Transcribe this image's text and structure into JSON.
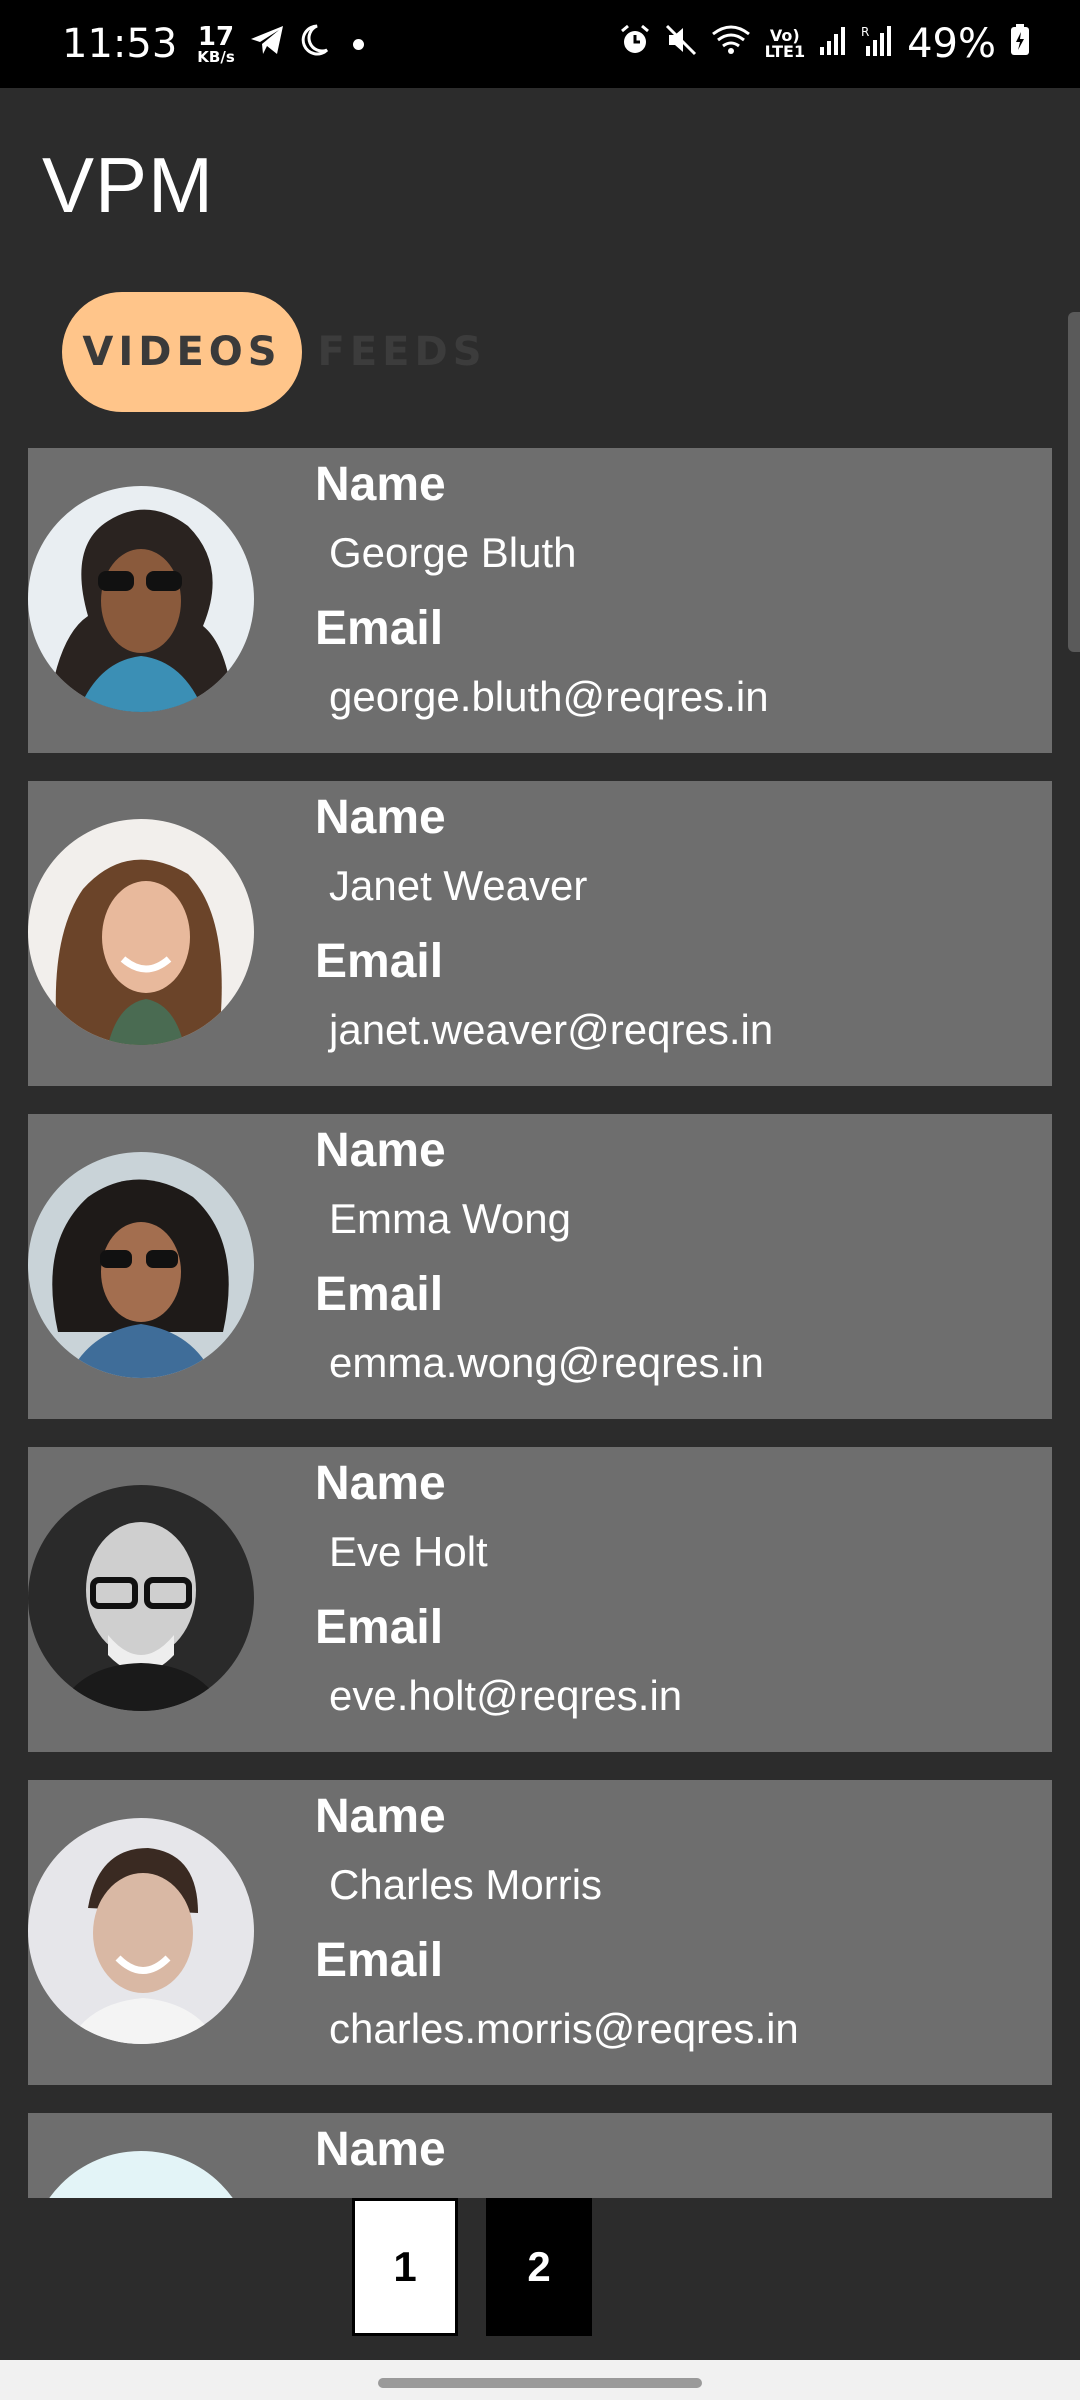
{
  "status_bar": {
    "time": "11:53",
    "speed_value": "17",
    "speed_unit": "KB/s",
    "battery": "49%",
    "icons": [
      "telegram-icon",
      "moon-icon",
      "alarm-icon",
      "mute-icon",
      "wifi-icon",
      "volte-icon",
      "signal-icon",
      "signal-roaming-icon",
      "battery-charging-icon"
    ]
  },
  "header": {
    "title": "VPM"
  },
  "tabs": [
    {
      "label": "VIDEOS",
      "selected": true
    },
    {
      "label": "FEEDS",
      "selected": false
    }
  ],
  "users": [
    {
      "name_label": "Name",
      "name": "George Bluth",
      "email_label": "Email",
      "email": "george.bluth@reqres.in"
    },
    {
      "name_label": "Name",
      "name": "Janet Weaver",
      "email_label": "Email",
      "email": "janet.weaver@reqres.in"
    },
    {
      "name_label": "Name",
      "name": "Emma Wong",
      "email_label": "Email",
      "email": "emma.wong@reqres.in"
    },
    {
      "name_label": "Name",
      "name": "Eve Holt",
      "email_label": "Email",
      "email": "eve.holt@reqres.in"
    },
    {
      "name_label": "Name",
      "name": "Charles Morris",
      "email_label": "Email",
      "email": "charles.morris@reqres.in"
    },
    {
      "name_label": "Name"
    }
  ],
  "pagination": {
    "pages": [
      "1",
      "2"
    ],
    "current": "1"
  },
  "colors": {
    "accent": "#ffc58a",
    "card": "#6e6e6e",
    "background": "#2c2c2c"
  }
}
